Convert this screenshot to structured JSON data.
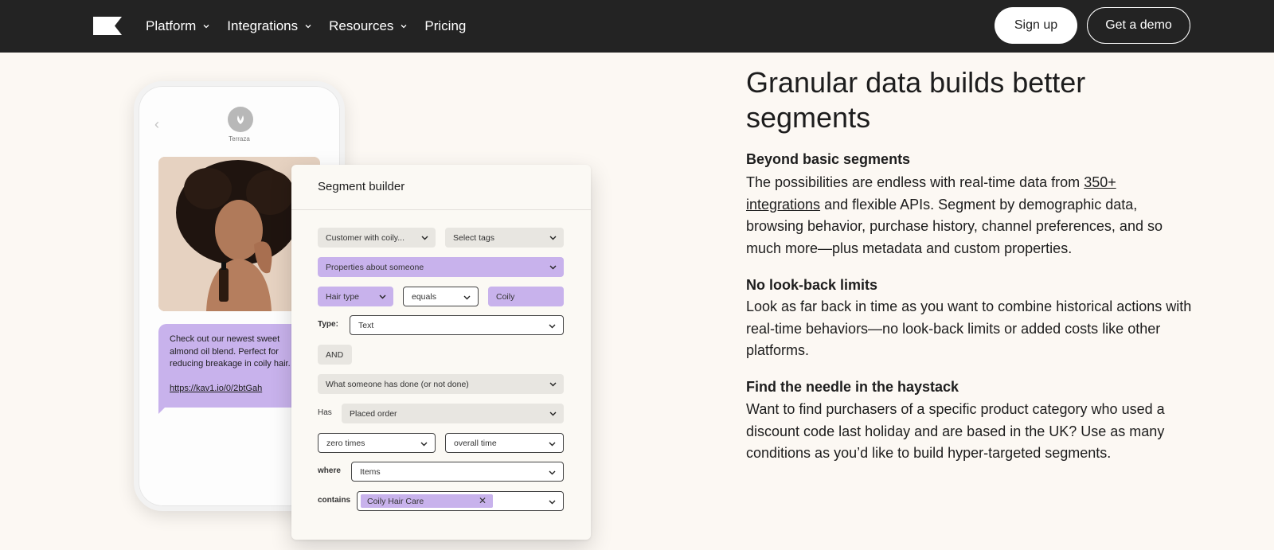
{
  "nav": {
    "items": [
      {
        "label": "Platform",
        "has_dropdown": true
      },
      {
        "label": "Integrations",
        "has_dropdown": true
      },
      {
        "label": "Resources",
        "has_dropdown": true
      },
      {
        "label": "Pricing",
        "has_dropdown": false
      }
    ],
    "signup_label": "Sign up",
    "demo_label": "Get a demo"
  },
  "phone": {
    "brand": "Terraza",
    "message_lines": [
      "Check out our newest sweet",
      "almond oil blend. Perfect for",
      "reducing breakage in coily hair."
    ],
    "message_link": "https://kav1.io/0/2btGah"
  },
  "builder": {
    "title": "Segment builder",
    "customer_select": "Customer with coily...",
    "tags_select": "Select tags",
    "properties_select": "Properties about someone",
    "property_name": "Hair type",
    "operator": "equals",
    "value": "Coily",
    "type_label": "Type:",
    "type_value": "Text",
    "and_label": "AND",
    "action_select": "What someone has done (or not done)",
    "has_label": "Has",
    "has_value": "Placed order",
    "frequency": "zero times",
    "timeframe": "overall time",
    "where_label": "where",
    "where_value": "Items",
    "contains_label": "contains",
    "contains_tag": "Coily Hair Care"
  },
  "content": {
    "heading": "Granular data builds better segments",
    "sections": [
      {
        "title": "Beyond basic segments",
        "body_pre": "The possibilities are endless with real-time data from ",
        "body_link": "350+ integrations",
        "body_post": " and flexible APIs.  Segment by demographic data, browsing behavior, purchase history, channel preferences, and so much more—plus metadata and custom properties."
      },
      {
        "title": "No look-back limits",
        "body": "Look as far back in time as you want to combine historical actions with real-time behaviors—no look-back limits or added costs like other platforms."
      },
      {
        "title": "Find the needle in the haystack",
        "body": "Want to find purchasers of a specific product category who used a discount code last holiday and are based in the UK? Use as many conditions as you’d like to build hyper-targeted segments."
      }
    ]
  },
  "colors": {
    "nav_bg": "#232323",
    "page_bg": "#fcf8f3",
    "accent_purple": "#c8b2ec",
    "field_grey": "#e8e6e1"
  }
}
